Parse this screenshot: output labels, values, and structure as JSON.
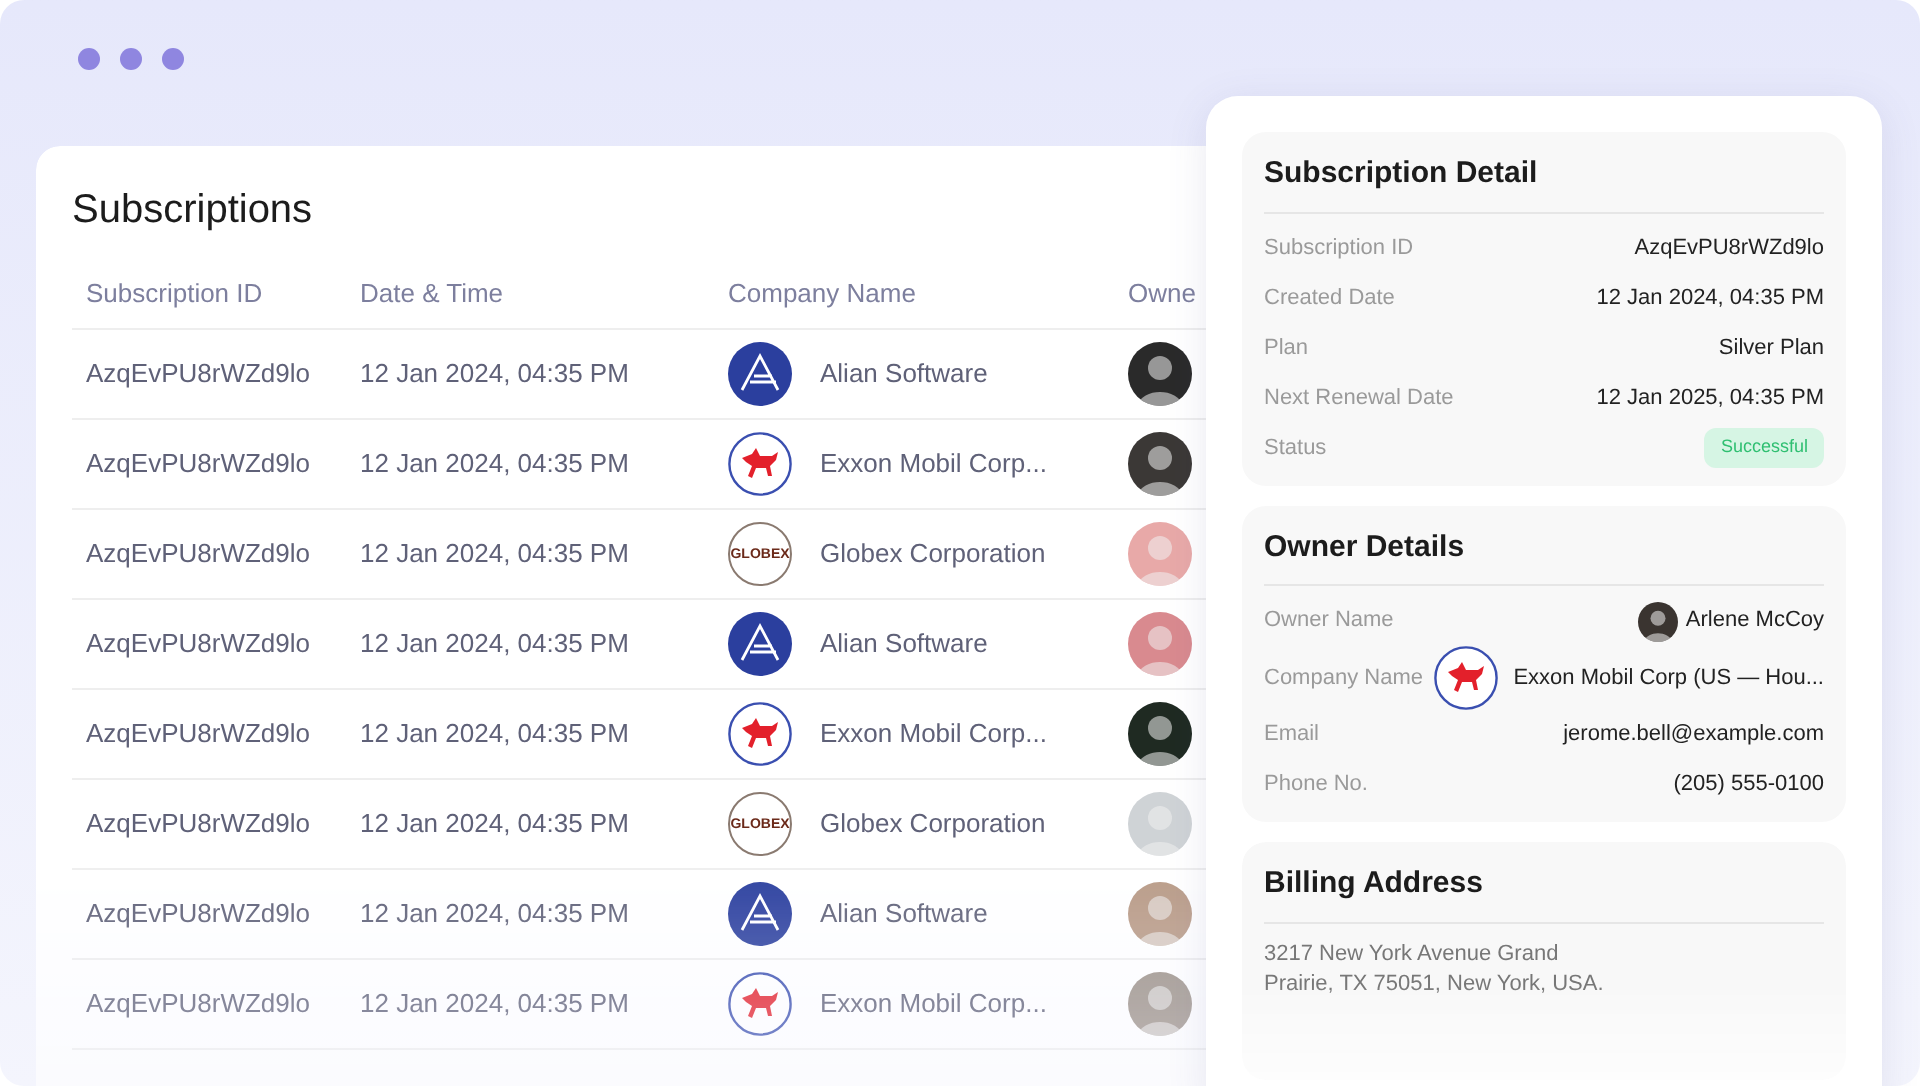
{
  "title": "Subscriptions",
  "table": {
    "columns": [
      "Subscription ID",
      "Date & Time",
      "Company Name",
      "Owne"
    ],
    "rows": [
      {
        "id": "AzqEvPU8rWZd9lo",
        "date": "12 Jan 2024, 04:35 PM",
        "company": "Alian Software",
        "kind": "alian"
      },
      {
        "id": "AzqEvPU8rWZd9lo",
        "date": "12 Jan 2024, 04:35 PM",
        "company": "Exxon Mobil Corp...",
        "kind": "exxon"
      },
      {
        "id": "AzqEvPU8rWZd9lo",
        "date": "12 Jan 2024, 04:35 PM",
        "company": "Globex Corporation",
        "kind": "globex",
        "logo_text": "GLOBEX"
      },
      {
        "id": "AzqEvPU8rWZd9lo",
        "date": "12 Jan 2024, 04:35 PM",
        "company": "Alian Software",
        "kind": "alian"
      },
      {
        "id": "AzqEvPU8rWZd9lo",
        "date": "12 Jan 2024, 04:35 PM",
        "company": "Exxon Mobil Corp...",
        "kind": "exxon"
      },
      {
        "id": "AzqEvPU8rWZd9lo",
        "date": "12 Jan 2024, 04:35 PM",
        "company": "Globex Corporation",
        "kind": "globex",
        "logo_text": "GLOBEX"
      },
      {
        "id": "AzqEvPU8rWZd9lo",
        "date": "12 Jan 2024, 04:35 PM",
        "company": "Alian Software",
        "kind": "alian"
      },
      {
        "id": "AzqEvPU8rWZd9lo",
        "date": "12 Jan 2024, 04:35 PM",
        "company": "Exxon Mobil Corp...",
        "kind": "exxon"
      }
    ]
  },
  "detail": {
    "title": "Subscription Detail",
    "fields": [
      {
        "label": "Subscription ID",
        "value": "AzqEvPU8rWZd9lo",
        "kind": "text"
      },
      {
        "label": "Created Date",
        "value": "12 Jan 2024, 04:35 PM",
        "kind": "text"
      },
      {
        "label": "Plan",
        "value": "Silver Plan",
        "kind": "text"
      },
      {
        "label": "Next Renewal Date",
        "value": "12 Jan 2025, 04:35 PM",
        "kind": "text"
      },
      {
        "label": "Status",
        "value": "Successful",
        "kind": "badge"
      }
    ]
  },
  "owner": {
    "title": "Owner Details",
    "fields": [
      {
        "label": "Owner Name",
        "value": "Arlene McCoy",
        "kind": "person"
      },
      {
        "label": "Company Name",
        "value": "Exxon Mobil Corp (US — Hou...",
        "kind": "company"
      },
      {
        "label": "Email",
        "value": "jerome.bell@example.com",
        "kind": "text"
      },
      {
        "label": "Phone No.",
        "value": "(205) 555-0100",
        "kind": "text"
      }
    ]
  },
  "billing": {
    "title": "Billing Address",
    "lines": [
      "3217 New York Avenue Grand",
      "Prairie, TX 75051, New York, USA."
    ]
  }
}
